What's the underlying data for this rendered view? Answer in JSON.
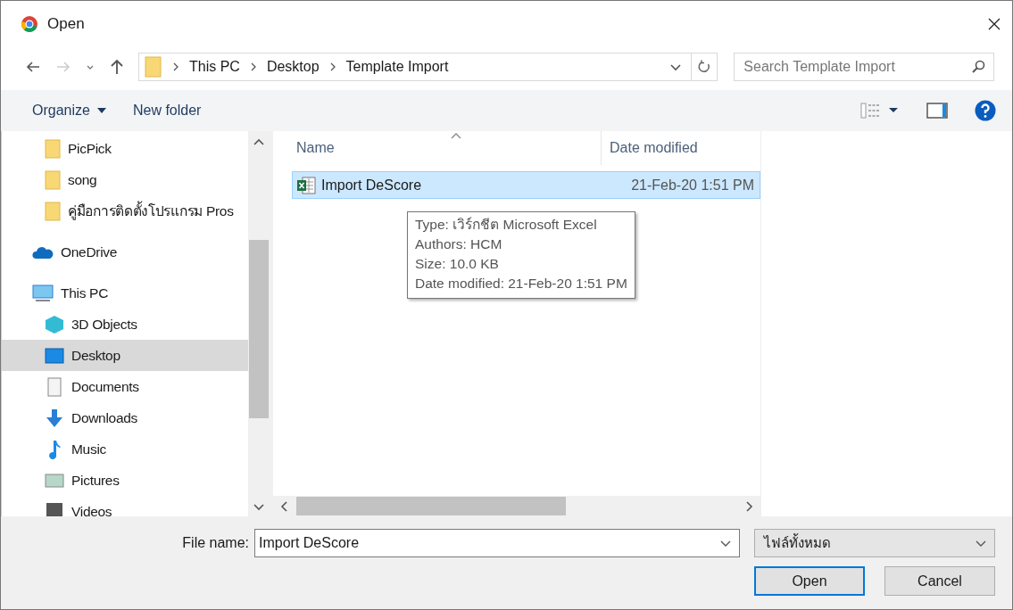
{
  "window": {
    "title": "Open"
  },
  "address": {
    "back_disabled": false,
    "forward_disabled": true,
    "crumbs": [
      "This PC",
      "Desktop",
      "Template Import"
    ]
  },
  "search": {
    "placeholder": "Search Template Import"
  },
  "toolbar": {
    "organize": "Organize",
    "new_folder": "New folder"
  },
  "sidebar": {
    "top_folders": [
      {
        "label": "PicPick",
        "kind": "folder",
        "selected": false
      },
      {
        "label": "song",
        "kind": "folder",
        "selected": false
      },
      {
        "label": "คู่มือการติดตั้งโปรแกรม Pros",
        "kind": "folder",
        "selected": false
      }
    ],
    "roots": [
      {
        "label": "OneDrive",
        "kind": "cloud",
        "selected": false
      },
      {
        "label": "This PC",
        "kind": "pc",
        "selected": false,
        "children": [
          {
            "label": "3D Objects",
            "kind": "cube",
            "selected": false
          },
          {
            "label": "Desktop",
            "kind": "desktop",
            "selected": true
          },
          {
            "label": "Documents",
            "kind": "document",
            "selected": false
          },
          {
            "label": "Downloads",
            "kind": "download",
            "selected": false
          },
          {
            "label": "Music",
            "kind": "music",
            "selected": false
          },
          {
            "label": "Pictures",
            "kind": "pictures",
            "selected": false
          },
          {
            "label": "Videos",
            "kind": "videos",
            "selected": false
          }
        ]
      }
    ]
  },
  "table": {
    "columns": [
      "Name",
      "Date modified"
    ],
    "rows": [
      {
        "name": "Import DeScore",
        "date": "21-Feb-20 1:51 PM",
        "selected": true
      }
    ]
  },
  "tooltip": [
    "Type: เวิร์กชีต Microsoft Excel",
    "Authors: HCM",
    "Size: 10.0 KB",
    "Date modified: 21-Feb-20 1:51 PM"
  ],
  "footer": {
    "file_name_label": "File name:",
    "file_name": "Import DeScore",
    "filter": "ไฟล์ทั้งหมด",
    "buttons": [
      "Open",
      "Cancel"
    ]
  }
}
